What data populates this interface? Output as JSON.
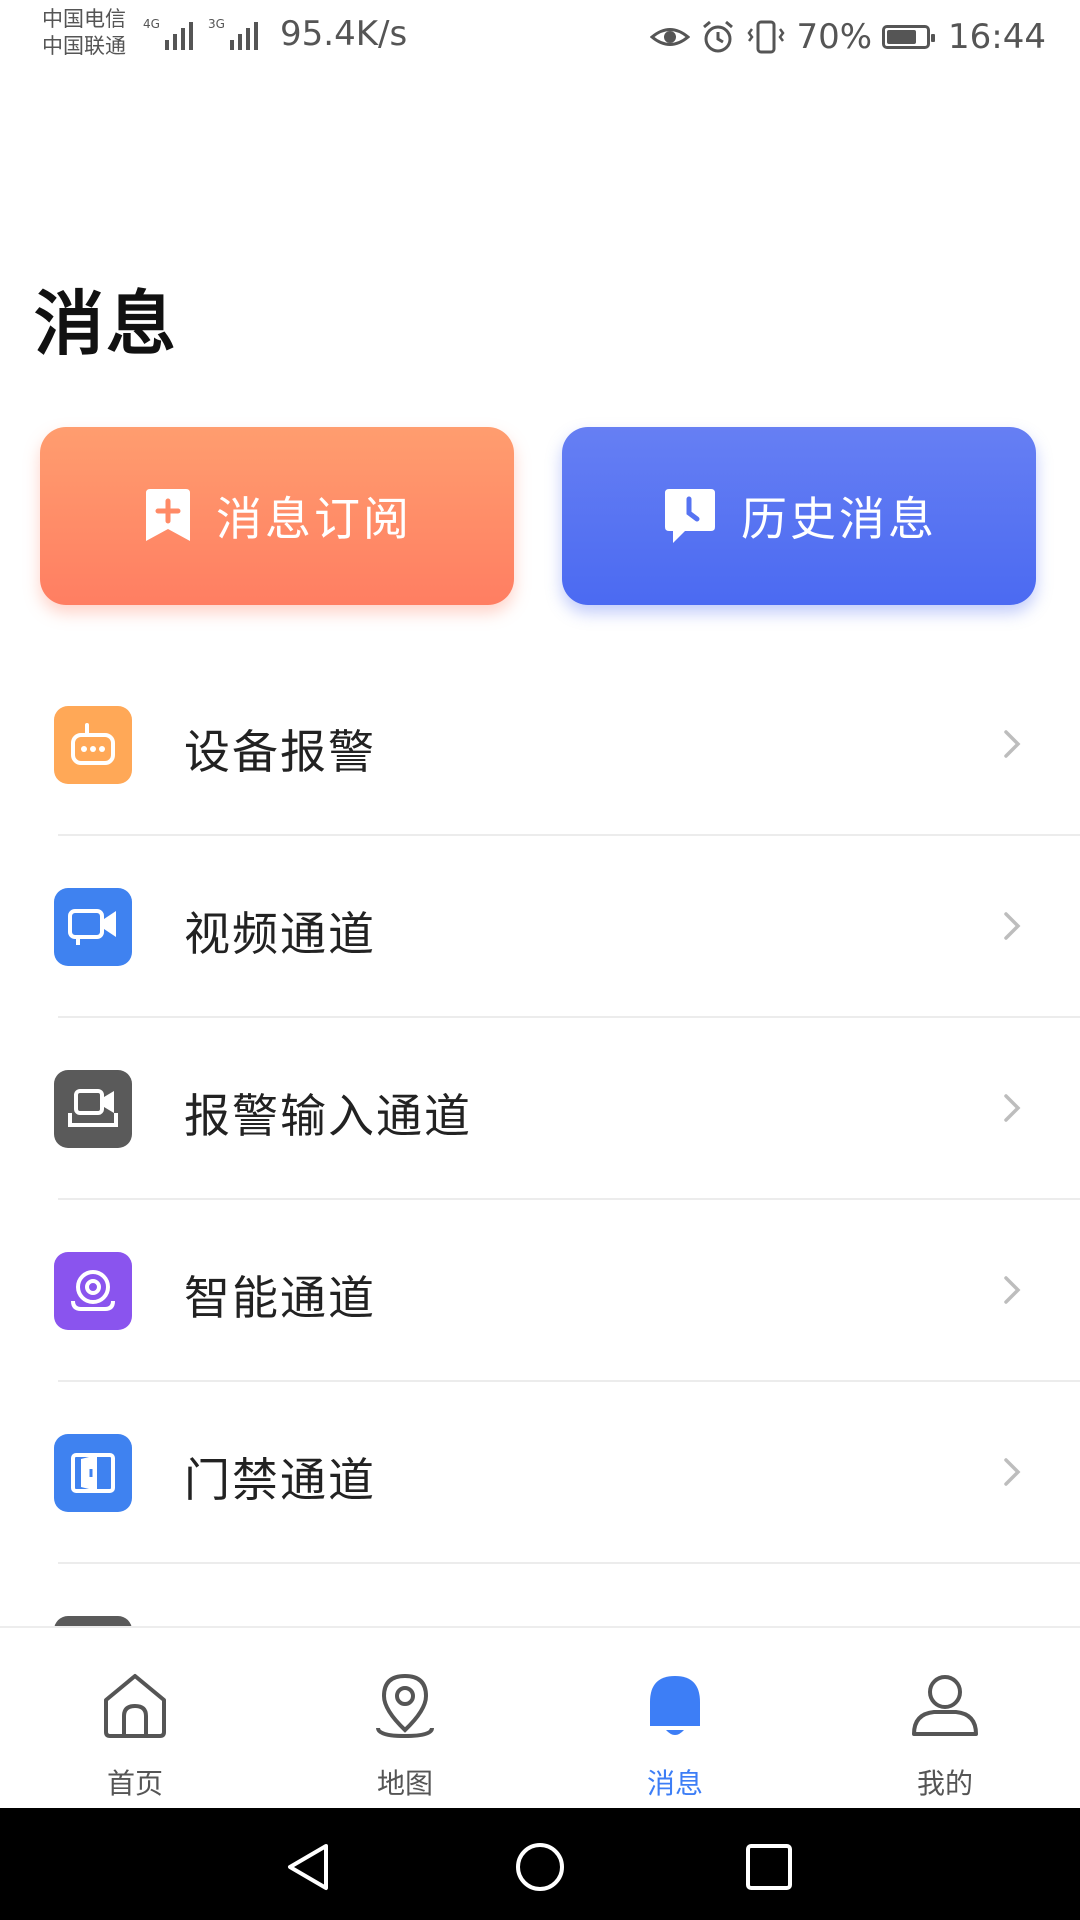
{
  "status_bar": {
    "carrier1": "中国电信",
    "carrier2": "中国联通",
    "net1": "4G",
    "net2": "3G",
    "speed": "95.4K/s",
    "battery": "70%",
    "time": "16:44"
  },
  "page": {
    "title": "消息"
  },
  "actions": {
    "subscribe_label": "消息订阅",
    "history_label": "历史消息"
  },
  "list": {
    "items": [
      {
        "label": "设备报警",
        "icon": "robot-device-icon",
        "color": "#ffa857"
      },
      {
        "label": "视频通道",
        "icon": "video-camera-icon",
        "color": "#3f82f0"
      },
      {
        "label": "报警输入通道",
        "icon": "alarm-input-icon",
        "color": "#5a5a5a"
      },
      {
        "label": "智能通道",
        "icon": "smart-camera-icon",
        "color": "#8a54ee"
      },
      {
        "label": "门禁通道",
        "icon": "door-icon",
        "color": "#3f82f0"
      }
    ]
  },
  "tabbar": {
    "tabs": [
      {
        "label": "首页",
        "icon": "home-icon"
      },
      {
        "label": "地图",
        "icon": "map-pin-icon"
      },
      {
        "label": "消息",
        "icon": "bell-icon",
        "active": true
      },
      {
        "label": "我的",
        "icon": "user-icon"
      }
    ]
  },
  "colors": {
    "accent": "#3d7ef6",
    "subscribe": "#ff8a66",
    "history": "#5673f2"
  }
}
